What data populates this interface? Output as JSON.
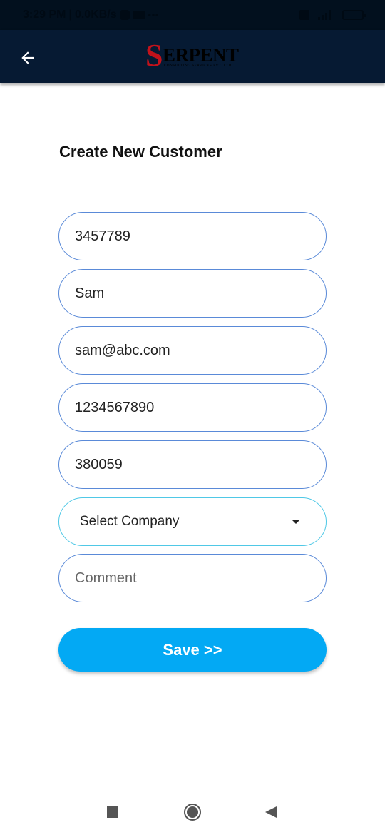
{
  "status_bar": {
    "time": "3:29 PM",
    "network_speed": "0.0KB/s",
    "separator": "|",
    "more_indicator": "•••"
  },
  "app_bar": {
    "back_icon": "arrow-left-icon",
    "logo": {
      "initial": "S",
      "rest": "ERPENT",
      "tagline": "CONSULTING SERVICES PVT. LTD."
    },
    "colors": {
      "background": "#061a33",
      "logo_initial": "#c2121b"
    }
  },
  "form": {
    "title": "Create New Customer",
    "fields": [
      {
        "name": "customer-id",
        "value": "3457789",
        "placeholder": ""
      },
      {
        "name": "name",
        "value": "Sam",
        "placeholder": ""
      },
      {
        "name": "email",
        "value": "sam@abc.com",
        "placeholder": ""
      },
      {
        "name": "phone",
        "value": "1234567890",
        "placeholder": ""
      },
      {
        "name": "pincode",
        "value": "380059",
        "placeholder": ""
      }
    ],
    "company_select": {
      "selected": "Select Company",
      "icon": "caret-down-icon"
    },
    "comment": {
      "value": "",
      "placeholder": "Comment"
    },
    "save_label": "Save >>",
    "colors": {
      "field_border": "#5a8ad8",
      "select_border": "#4fc8e6",
      "save_button": "#03a9f4"
    }
  },
  "nav_bar": {
    "recents_icon": "square-icon",
    "home_icon": "circle-icon",
    "back_icon": "triangle-back-icon"
  }
}
